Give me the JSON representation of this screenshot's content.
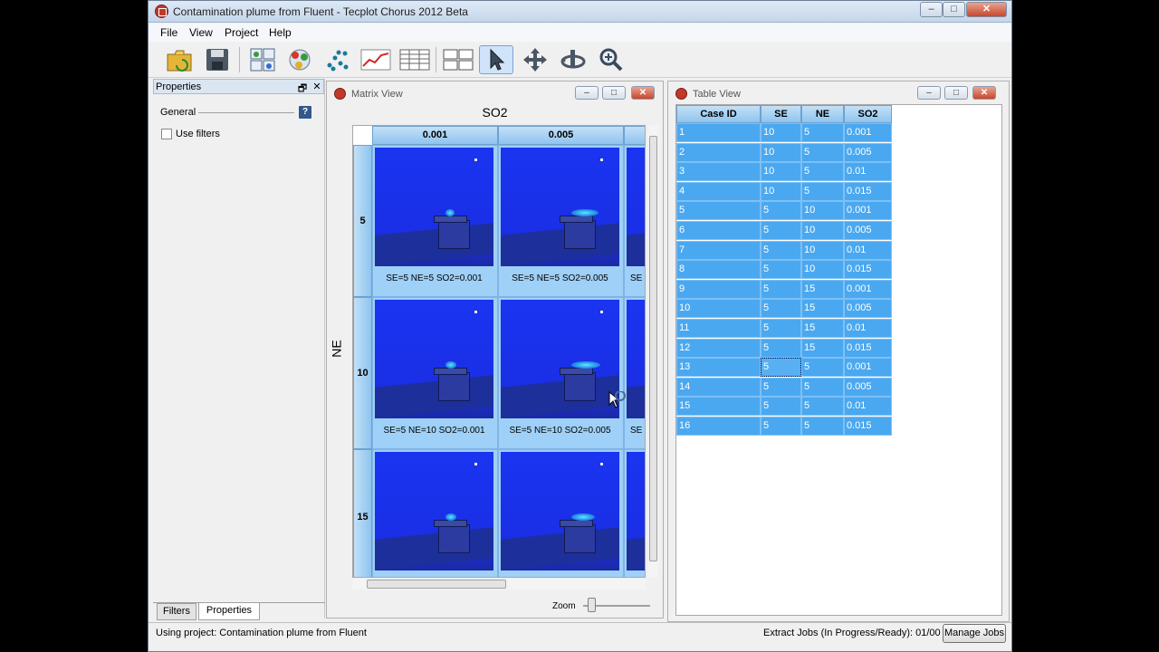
{
  "window": {
    "title": "Contamination plume from Fluent - Tecplot Chorus 2012 Beta",
    "min_label": "–",
    "max_label": "□",
    "close_label": "✕"
  },
  "menu": [
    "File",
    "View",
    "Project",
    "Help"
  ],
  "toolbar": {
    "icons": [
      "open-project-icon",
      "save-icon",
      "matrix-plot-icon",
      "scatter-3d-icon",
      "scatter-plot-icon",
      "line-plot-icon",
      "table-icon",
      "layout-icon",
      "pointer-icon",
      "pan-icon",
      "rotate-icon",
      "zoom-icon"
    ],
    "active": "pointer-icon"
  },
  "properties": {
    "title": "Properties",
    "float_label": "🗗",
    "close_label": "✕",
    "general_label": "General",
    "help_label": "?",
    "use_filters_label": "Use filters",
    "tabs": [
      "Filters",
      "Properties"
    ],
    "selected_tab": "Properties"
  },
  "matrix_view": {
    "title": "Matrix View",
    "col_var": "SO2",
    "row_var": "NE",
    "columns": [
      "0.001",
      "0.005"
    ],
    "rows": [
      "5",
      "10",
      "15"
    ],
    "captions": [
      [
        "SE=5  NE=5  SO2=0.001",
        "SE=5  NE=5  SO2=0.005"
      ],
      [
        "SE=5  NE=10  SO2=0.001",
        "SE=5  NE=10  SO2=0.005"
      ],
      [
        "",
        ""
      ]
    ],
    "partial_caption": "SE",
    "zoom_label": "Zoom"
  },
  "table_view": {
    "title": "Table View",
    "headers": [
      "Case ID",
      "SE",
      "NE",
      "SO2"
    ],
    "rows": [
      [
        "1",
        "10",
        "5",
        "0.001"
      ],
      [
        "2",
        "10",
        "5",
        "0.005"
      ],
      [
        "3",
        "10",
        "5",
        "0.01"
      ],
      [
        "4",
        "10",
        "5",
        "0.015"
      ],
      [
        "5",
        "5",
        "10",
        "0.001"
      ],
      [
        "6",
        "5",
        "10",
        "0.005"
      ],
      [
        "7",
        "5",
        "10",
        "0.01"
      ],
      [
        "8",
        "5",
        "10",
        "0.015"
      ],
      [
        "9",
        "5",
        "15",
        "0.001"
      ],
      [
        "10",
        "5",
        "15",
        "0.005"
      ],
      [
        "11",
        "5",
        "15",
        "0.01"
      ],
      [
        "12",
        "5",
        "15",
        "0.015"
      ],
      [
        "13",
        "5",
        "5",
        "0.001"
      ],
      [
        "14",
        "5",
        "5",
        "0.005"
      ],
      [
        "15",
        "5",
        "5",
        "0.01"
      ],
      [
        "16",
        "5",
        "5",
        "0.015"
      ]
    ]
  },
  "status": {
    "project": "Using project: Contamination plume from Fluent",
    "jobs": "Extract Jobs (In Progress/Ready):  01/00",
    "manage_jobs": "Manage Jobs"
  }
}
